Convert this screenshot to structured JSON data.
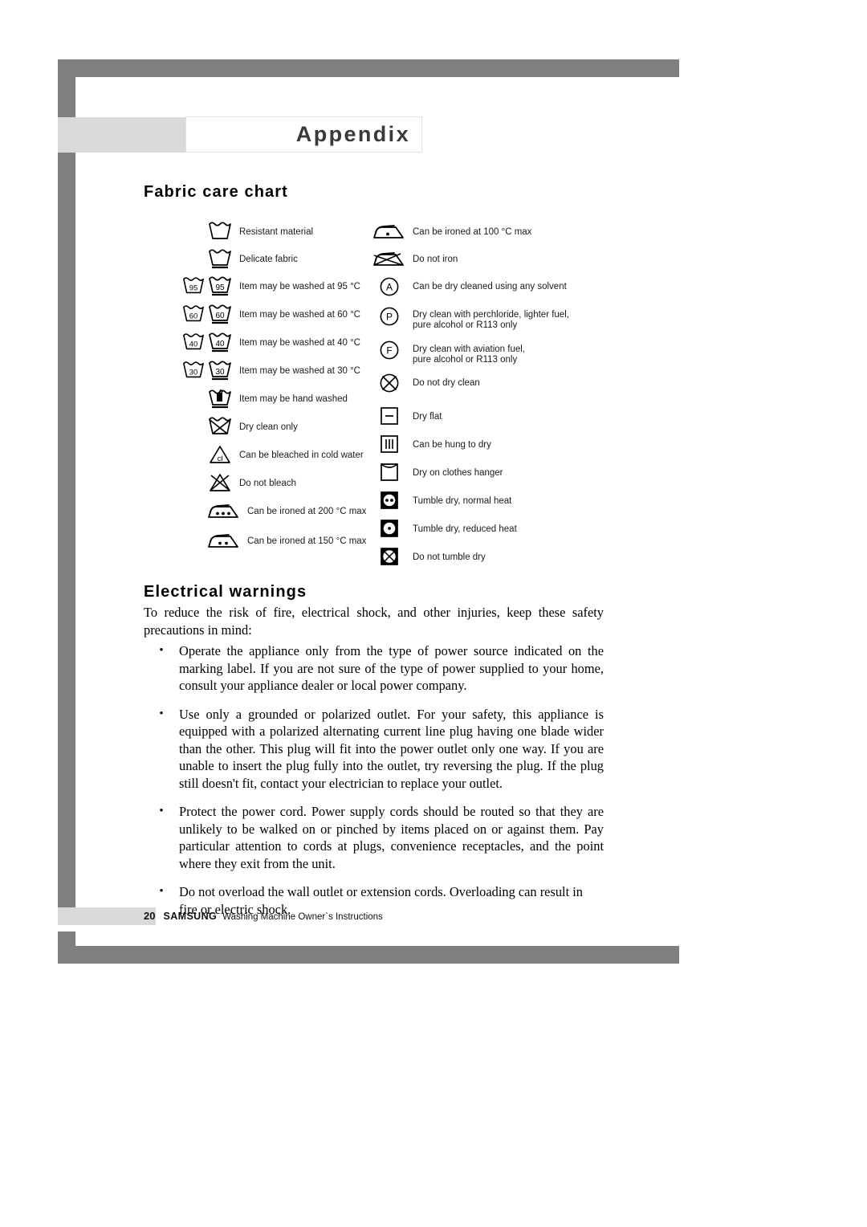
{
  "document": {
    "title": "Appendix",
    "page_number": "20",
    "brand": "SAMSUNG",
    "footer_title": "Washing Machine Owner`s Instructions"
  },
  "colors": {
    "frame_gray": "#808080",
    "band_gray": "#d9d9d9",
    "title_text": "#3a3a3a",
    "body_text": "#000000"
  },
  "sections": {
    "fabric": {
      "heading": "Fabric care chart"
    },
    "electrical": {
      "heading": "Electrical warnings",
      "intro": "To reduce the risk of fire, electrical shock, and other injuries, keep these safety precautions in mind:",
      "bullet_char": "•",
      "bullets": [
        "Operate the appliance only from the type of power source indicated on the marking label.  If you are not sure of the type of power supplied to your home, consult your appliance dealer or local power company.",
        "Use only a grounded or polarized outlet.  For your safety, this appliance is equipped with a polarized alternating current line plug having one blade wider than the other.  This plug will fit into the power outlet only one way.  If you are unable to insert the plug fully into the outlet, try reversing the plug.  If the plug still doesn't fit, contact your electrician to replace your outlet.",
        "Protect the power cord. Power supply cords should be routed so that they are unlikely to be walked on or pinched by items placed on or against them.  Pay particular attention to cords at plugs, convenience receptacles, and the point where they exit from the unit.",
        "Do not overload the wall outlet or extension cords.  Overloading can result in fire or electric shock."
      ]
    }
  },
  "care_chart": {
    "left_column": [
      {
        "icon": "wash-tub-resistant-icon",
        "label": "Resistant material"
      },
      {
        "icon": "wash-tub-delicate-icon",
        "label": "Delicate fabric"
      },
      {
        "icon": "wash-tub-temp-pair-icon",
        "temp": "95",
        "label": "Item may be washed at 95 °C"
      },
      {
        "icon": "wash-tub-temp-pair-icon",
        "temp": "60",
        "label": "Item may be washed at 60 °C"
      },
      {
        "icon": "wash-tub-temp-pair-icon",
        "temp": "40",
        "label": "Item may be washed at 40 °C"
      },
      {
        "icon": "wash-tub-temp-pair-icon",
        "temp": "30",
        "label": "Item may be washed at 30 °C"
      },
      {
        "icon": "hand-wash-icon",
        "label": "Item may be hand washed"
      },
      {
        "icon": "do-not-wash-icon",
        "label": "Dry clean only"
      },
      {
        "icon": "bleach-cold-water-icon",
        "label": "Can be bleached in cold water"
      },
      {
        "icon": "do-not-bleach-icon",
        "label": "Do not bleach"
      },
      {
        "icon": "iron-three-dots-icon",
        "label": "Can be ironed at 200 °C max"
      },
      {
        "icon": "iron-two-dots-icon",
        "label": "Can be ironed at 150 °C max"
      }
    ],
    "right_column": [
      {
        "icon": "iron-one-dot-icon",
        "label": "Can be ironed at 100 °C  max"
      },
      {
        "icon": "do-not-iron-icon",
        "label": "Do not iron"
      },
      {
        "icon": "dry-clean-any-solvent-icon",
        "letter": "A",
        "label": "Can be dry cleaned using any solvent"
      },
      {
        "icon": "dry-clean-perchloride-icon",
        "letter": "P",
        "label": "Dry clean with perchloride, lighter fuel,\npure alcohol or R113 only"
      },
      {
        "icon": "dry-clean-aviation-fuel-icon",
        "letter": "F",
        "label": "Dry clean with aviation fuel,\npure alcohol or R113 only"
      },
      {
        "icon": "do-not-dry-clean-icon",
        "label": "Do not dry clean"
      },
      {
        "icon": "dry-flat-icon",
        "label": "Dry flat"
      },
      {
        "icon": "hang-to-dry-icon",
        "label": "Can be hung to dry"
      },
      {
        "icon": "drip-dry-hanger-icon",
        "label": "Dry on clothes hanger"
      },
      {
        "icon": "tumble-dry-normal-icon",
        "label": " Tumble dry, normal heat"
      },
      {
        "icon": "tumble-dry-reduced-icon",
        "label": "Tumble dry, reduced heat"
      },
      {
        "icon": "do-not-tumble-dry-icon",
        "label": "Do not tumble dry"
      }
    ]
  }
}
